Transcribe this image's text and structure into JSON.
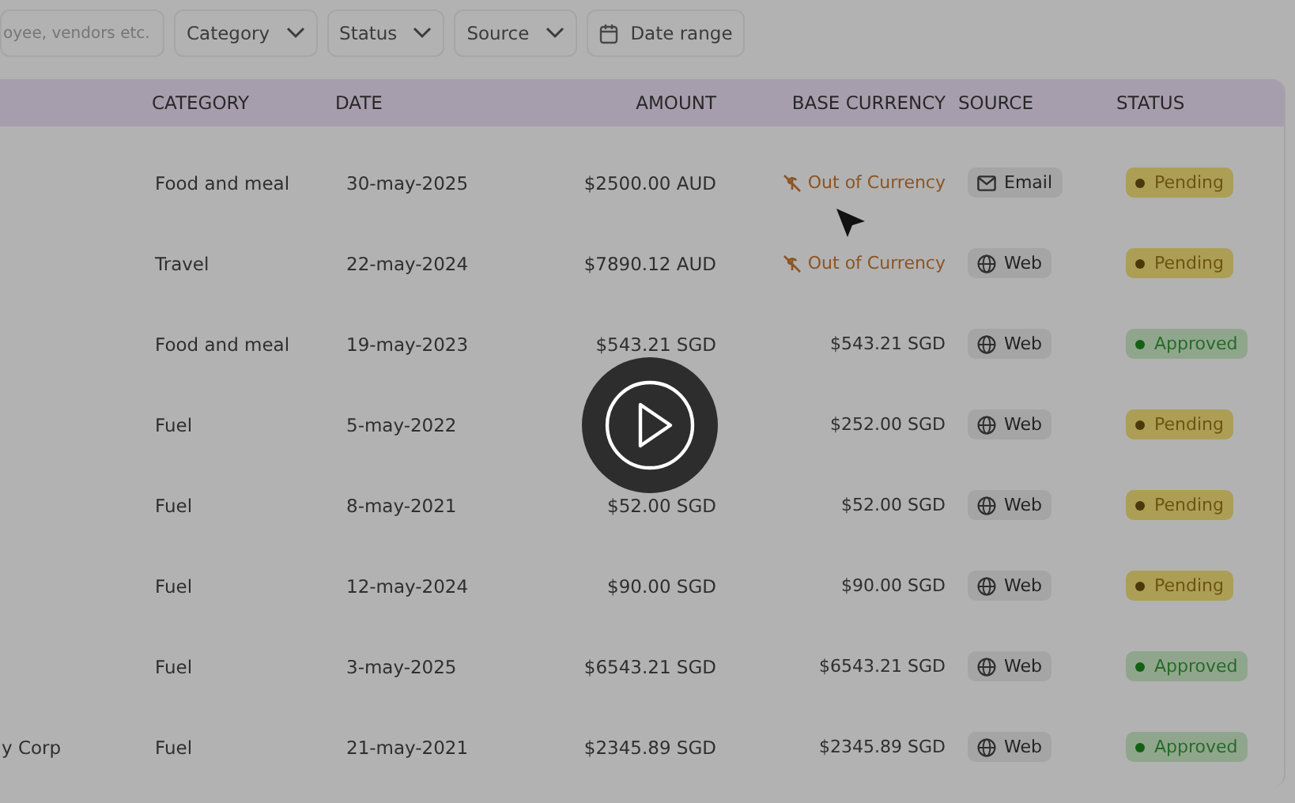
{
  "filters": {
    "search": {
      "placeholder": "oyee, vendors etc."
    },
    "dropdowns": [
      {
        "label": "Category"
      },
      {
        "label": "Status"
      },
      {
        "label": "Source"
      }
    ],
    "date_range": {
      "label": "Date range"
    }
  },
  "table": {
    "columns": [
      "CATEGORY",
      "DATE",
      "AMOUNT",
      "BASE CURRENCY",
      "SOURCE",
      "STATUS"
    ],
    "rows": [
      {
        "category": "Food and meal",
        "date": "30-may-2025",
        "amount": "$2500.00 AUD",
        "base": {
          "kind": "warning",
          "text": "Out of Currency"
        },
        "source": {
          "kind": "email",
          "label": "Email"
        },
        "status": {
          "kind": "pending",
          "label": "Pending"
        }
      },
      {
        "category": "Travel",
        "date": "22-may-2024",
        "amount": "$7890.12 AUD",
        "base": {
          "kind": "warning",
          "text": "Out of Currency"
        },
        "source": {
          "kind": "web",
          "label": "Web"
        },
        "status": {
          "kind": "pending",
          "label": "Pending"
        }
      },
      {
        "category": "Food and meal",
        "date": "19-may-2023",
        "amount": "$543.21 SGD",
        "base": {
          "kind": "value",
          "text": "$543.21 SGD"
        },
        "source": {
          "kind": "web",
          "label": "Web"
        },
        "status": {
          "kind": "approved",
          "label": "Approved"
        }
      },
      {
        "category": "Fuel",
        "date": "5-may-2022",
        "base": {
          "kind": "value",
          "text": "$252.00 SGD"
        },
        "source": {
          "kind": "web",
          "label": "Web"
        },
        "status": {
          "kind": "pending",
          "label": "Pending"
        }
      },
      {
        "category": "Fuel",
        "date": "8-may-2021",
        "amount": "$52.00 SGD",
        "base": {
          "kind": "value",
          "text": "$52.00 SGD"
        },
        "source": {
          "kind": "web",
          "label": "Web"
        },
        "status": {
          "kind": "pending",
          "label": "Pending"
        }
      },
      {
        "category": "Fuel",
        "date": "12-may-2024",
        "amount": "$90.00 SGD",
        "base": {
          "kind": "value",
          "text": "$90.00 SGD"
        },
        "source": {
          "kind": "web",
          "label": "Web"
        },
        "status": {
          "kind": "pending",
          "label": "Pending"
        }
      },
      {
        "category": "Fuel",
        "date": "3-may-2025",
        "amount": "$6543.21 SGD",
        "base": {
          "kind": "value",
          "text": "$6543.21 SGD"
        },
        "source": {
          "kind": "web",
          "label": "Web"
        },
        "status": {
          "kind": "approved",
          "label": "Approved"
        }
      },
      {
        "name": "y Corp",
        "category": "Fuel",
        "date": "21-may-2021",
        "amount": "$2345.89 SGD",
        "base": {
          "kind": "value",
          "text": "$2345.89 SGD"
        },
        "source": {
          "kind": "web",
          "label": "Web"
        },
        "status": {
          "kind": "approved",
          "label": "Approved"
        }
      }
    ]
  }
}
